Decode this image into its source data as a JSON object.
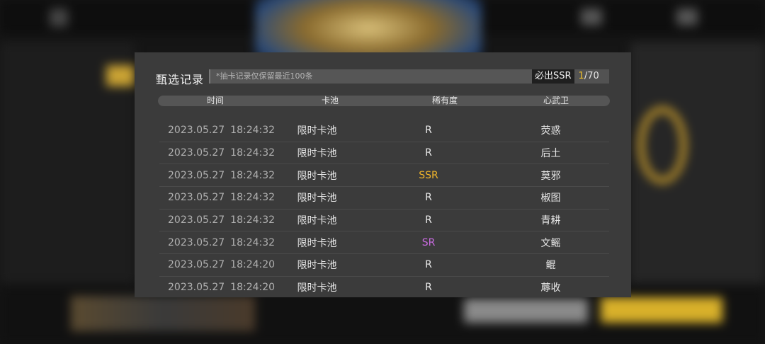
{
  "modal": {
    "title": "甄选记录",
    "notice": "*抽卡记录仅保留最近100条",
    "ssr_label": "必出SSR",
    "ssr_current": "1",
    "ssr_separator": "/",
    "ssr_total": "70"
  },
  "table": {
    "headers": {
      "time": "时间",
      "pool": "卡池",
      "rarity": "稀有度",
      "name": "心武卫"
    },
    "rows": [
      {
        "date": "2023.05.27",
        "time": "18:24:32",
        "pool": "限时卡池",
        "rarity": "R",
        "name": "荧惑"
      },
      {
        "date": "2023.05.27",
        "time": "18:24:32",
        "pool": "限时卡池",
        "rarity": "R",
        "name": "后土"
      },
      {
        "date": "2023.05.27",
        "time": "18:24:32",
        "pool": "限时卡池",
        "rarity": "SSR",
        "name": "莫邪"
      },
      {
        "date": "2023.05.27",
        "time": "18:24:32",
        "pool": "限时卡池",
        "rarity": "R",
        "name": "椒图"
      },
      {
        "date": "2023.05.27",
        "time": "18:24:32",
        "pool": "限时卡池",
        "rarity": "R",
        "name": "青耕"
      },
      {
        "date": "2023.05.27",
        "time": "18:24:32",
        "pool": "限时卡池",
        "rarity": "SR",
        "name": "文鳐"
      },
      {
        "date": "2023.05.27",
        "time": "18:24:20",
        "pool": "限时卡池",
        "rarity": "R",
        "name": "鲲"
      },
      {
        "date": "2023.05.27",
        "time": "18:24:20",
        "pool": "限时卡池",
        "rarity": "R",
        "name": "蓐收"
      }
    ]
  },
  "colors": {
    "ssr": "#f0b52a",
    "sr": "#c96be0",
    "r": "#eaeaea",
    "counter_highlight": "#f0c02a"
  }
}
